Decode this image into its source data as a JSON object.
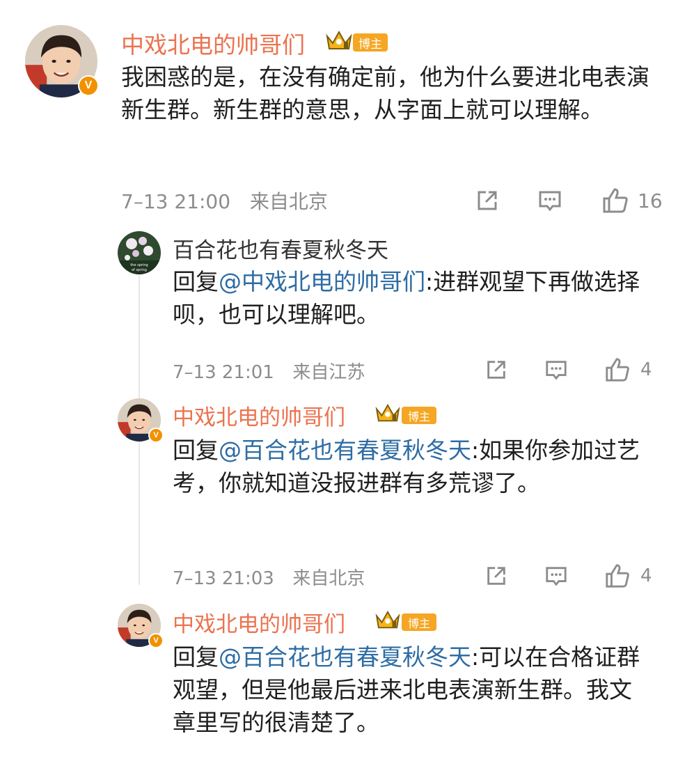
{
  "comments": [
    {
      "author": "中戏北电的帅哥们",
      "badge": "博主",
      "body": "我困惑的是，在没有确定前，他为什么要进北电表演新生群。新生群的意思，从字面上就可以理解。",
      "time": "7–13 21:00",
      "location": "来自北京",
      "likes": "16"
    }
  ],
  "replies": [
    {
      "author": "百合花也有春夏秋冬天",
      "reply_prefix": "回复",
      "mention": "@中戏北电的帅哥们",
      "body": ":进群观望下再做选择呗，也可以理解吧。",
      "time": "7–13 21:01",
      "location": "来自江苏",
      "likes": "4",
      "avatar_caption": "the spring of spring"
    },
    {
      "author": "中戏北电的帅哥们",
      "badge": "博主",
      "reply_prefix": "回复",
      "mention": "@百合花也有春夏秋冬天",
      "body": ":如果你参加过艺考，你就知道没报进群有多荒谬了。",
      "time": "7–13 21:03",
      "location": "来自北京",
      "likes": "4"
    },
    {
      "author": "中戏北电的帅哥们",
      "badge": "博主",
      "reply_prefix": "回复",
      "mention": "@百合花也有春夏秋冬天",
      "body": ":可以在合格证群观望，但是他最后进来北电表演新生群。我文章里写的很清楚了。"
    }
  ],
  "icons": {
    "share": "share-icon",
    "comment": "comment-icon",
    "like": "like-icon",
    "verified": "verified-v-icon",
    "crown": "crown-icon"
  },
  "colors": {
    "author_orange": "#eb7350",
    "mention_blue": "#2e6ca4",
    "meta_gray": "#8c8c8c",
    "badge_gold": "#f5a623",
    "verified_orange": "#f29100"
  }
}
